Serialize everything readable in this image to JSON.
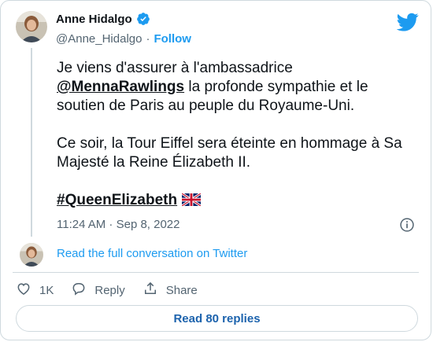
{
  "author": {
    "name": "Anne Hidalgo",
    "handle": "@Anne_Hidalgo",
    "separator": "·",
    "follow_label": "Follow"
  },
  "tweet": {
    "line1": "Je viens d'assurer à l'ambassadrice",
    "mention": "@MennaRawlings",
    "line2_rest": " la profonde sympathie et le soutien de Paris au peuple du Royaume-Uni.",
    "paragraph2": "Ce soir, la Tour Eiffel sera éteinte en hommage à Sa Majesté la Reine Élizabeth II.",
    "hashtag": "#QueenElizabeth",
    "timestamp": "11:24 AM · Sep 8, 2022"
  },
  "conversation_link": "Read the full conversation on Twitter",
  "actions": {
    "like_count": "1K",
    "reply_label": "Reply",
    "share_label": "Share"
  },
  "replies_button": "Read 80 replies",
  "icons": {
    "verified": "verified-badge-icon",
    "logo": "twitter-bird-icon",
    "info": "info-icon",
    "like": "heart-icon",
    "reply": "reply-bubble-icon",
    "share": "share-icon",
    "flag": "uk-flag-emoji"
  },
  "colors": {
    "accent": "#1d9bf0",
    "text": "#0f1419",
    "muted": "#536471",
    "border": "#cfd9de",
    "button_text": "#1d63ad"
  }
}
